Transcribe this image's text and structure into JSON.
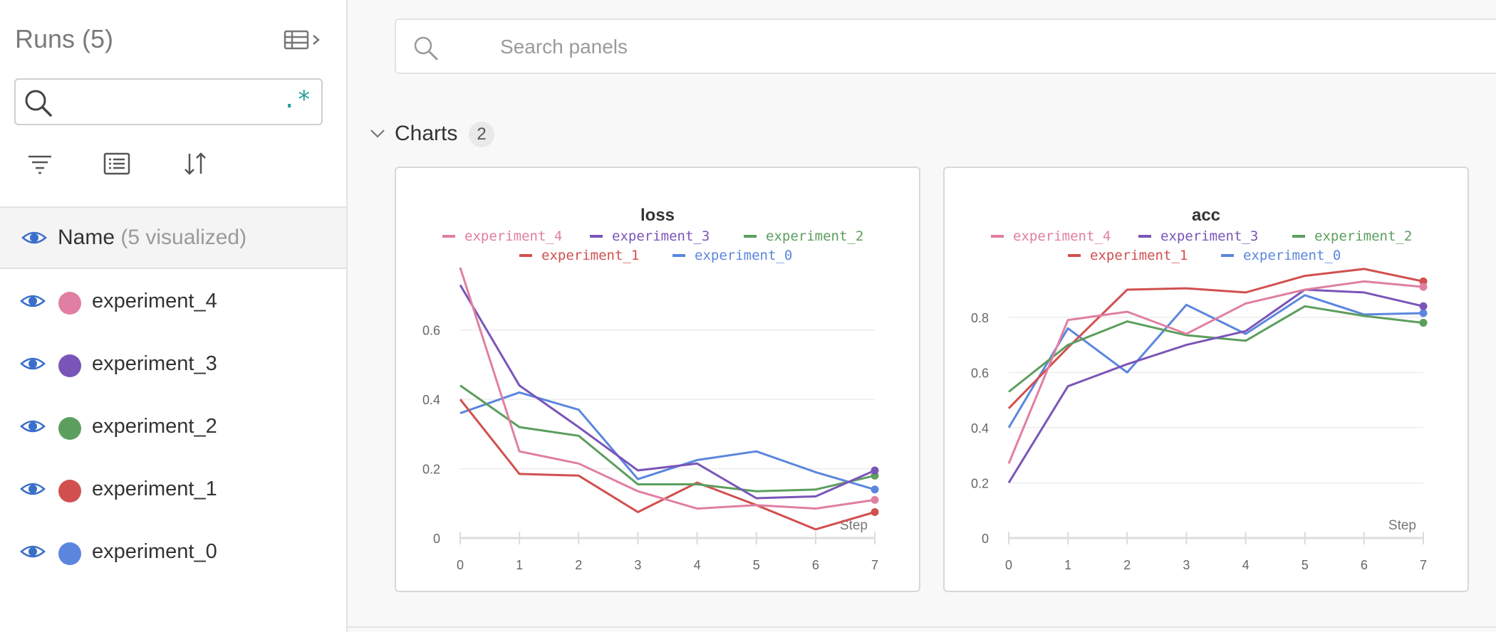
{
  "sidebar": {
    "title": "Runs (5)",
    "search": {
      "value": "",
      "regex_label": ".*"
    },
    "name_header": {
      "label": "Name",
      "sub": "(5 visualized)"
    },
    "runs": [
      {
        "name": "experiment_4",
        "color": "#e07fa1"
      },
      {
        "name": "experiment_3",
        "color": "#7a55b8"
      },
      {
        "name": "experiment_2",
        "color": "#5c9e5e"
      },
      {
        "name": "experiment_1",
        "color": "#d1504f"
      },
      {
        "name": "experiment_0",
        "color": "#5b86de"
      }
    ],
    "icons": [
      "table-icon",
      "filter-icon",
      "columns-icon",
      "sort-icon",
      "eye-icon"
    ]
  },
  "main": {
    "search": {
      "placeholder": "Search panels"
    },
    "section": {
      "title": "Charts",
      "count": "2"
    }
  },
  "chart_data": [
    {
      "type": "line",
      "title": "loss",
      "xlabel": "Step",
      "ylabel": "",
      "x": [
        0,
        1,
        2,
        3,
        4,
        5,
        6,
        7
      ],
      "xlim": [
        0,
        7
      ],
      "ylim": [
        0,
        0.78
      ],
      "yticks": [
        0,
        0.2,
        0.4,
        0.6
      ],
      "ytick_labels": [
        "0",
        "0.2",
        "0.4",
        "0.6"
      ],
      "grid": true,
      "legend": "top",
      "series": [
        {
          "name": "experiment_4",
          "color": "#e07fa1",
          "values": [
            0.78,
            0.25,
            0.215,
            0.135,
            0.085,
            0.095,
            0.085,
            0.11
          ]
        },
        {
          "name": "experiment_3",
          "color": "#7a55b8",
          "values": [
            0.73,
            0.44,
            0.32,
            0.195,
            0.215,
            0.115,
            0.12,
            0.195
          ]
        },
        {
          "name": "experiment_2",
          "color": "#5c9e5e",
          "values": [
            0.44,
            0.32,
            0.295,
            0.155,
            0.155,
            0.135,
            0.14,
            0.18
          ]
        },
        {
          "name": "experiment_1",
          "color": "#d1504f",
          "values": [
            0.4,
            0.185,
            0.18,
            0.075,
            0.16,
            0.095,
            0.025,
            0.075
          ]
        },
        {
          "name": "experiment_0",
          "color": "#5b86de",
          "values": [
            0.36,
            0.42,
            0.37,
            0.17,
            0.225,
            0.25,
            0.19,
            0.14
          ]
        }
      ]
    },
    {
      "type": "line",
      "title": "acc",
      "xlabel": "Step",
      "ylabel": "",
      "x": [
        0,
        1,
        2,
        3,
        4,
        5,
        6,
        7
      ],
      "xlim": [
        0,
        7
      ],
      "ylim": [
        0,
        0.98
      ],
      "yticks": [
        0,
        0.2,
        0.4,
        0.6,
        0.8
      ],
      "ytick_labels": [
        "0",
        "0.2",
        "0.4",
        "0.6",
        "0.8"
      ],
      "grid": true,
      "legend": "top",
      "series": [
        {
          "name": "experiment_4",
          "color": "#e07fa1",
          "values": [
            0.27,
            0.79,
            0.82,
            0.74,
            0.85,
            0.9,
            0.93,
            0.91
          ]
        },
        {
          "name": "experiment_3",
          "color": "#7a55b8",
          "values": [
            0.2,
            0.55,
            0.63,
            0.7,
            0.75,
            0.9,
            0.89,
            0.84
          ]
        },
        {
          "name": "experiment_2",
          "color": "#5c9e5e",
          "values": [
            0.53,
            0.7,
            0.785,
            0.735,
            0.715,
            0.84,
            0.805,
            0.78
          ]
        },
        {
          "name": "experiment_1",
          "color": "#d1504f",
          "values": [
            0.47,
            0.69,
            0.9,
            0.905,
            0.89,
            0.95,
            0.975,
            0.93
          ]
        },
        {
          "name": "experiment_0",
          "color": "#5b86de",
          "values": [
            0.4,
            0.76,
            0.6,
            0.845,
            0.74,
            0.88,
            0.81,
            0.815
          ]
        }
      ]
    }
  ]
}
